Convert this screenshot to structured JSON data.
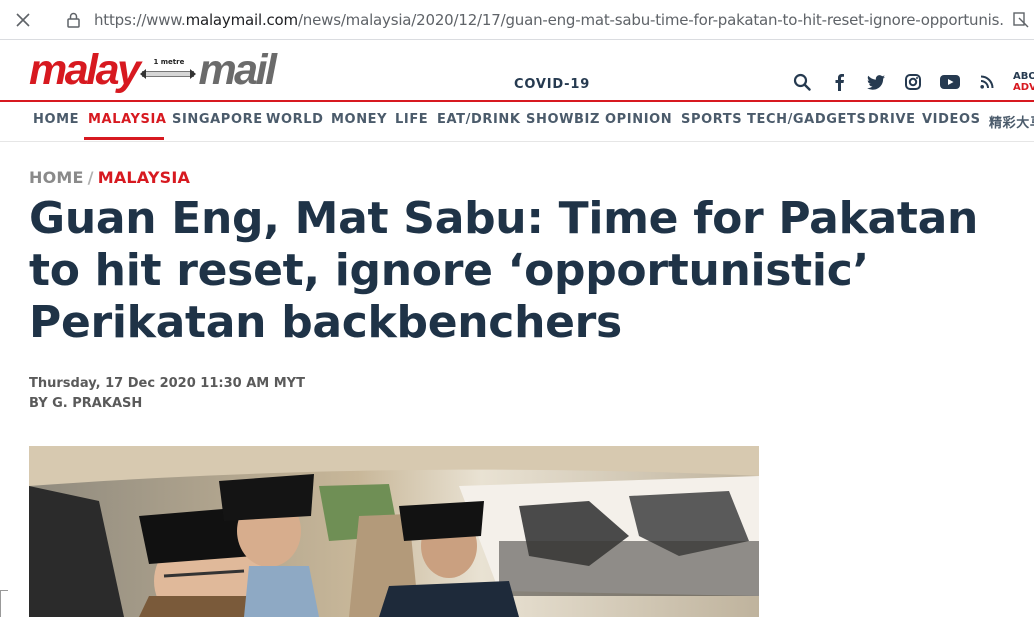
{
  "browser": {
    "url_prefix": "https://www.",
    "url_host": "malaymail.com",
    "url_path": "/news/malaysia/2020/12/17/guan-eng-mat-sabu-time-for-pakatan-to-hit-reset-ignore-opportunis..."
  },
  "header": {
    "logo_left": "malay",
    "logo_ruler": "1 metre",
    "logo_right": "mail",
    "covid_label": "COVID-19",
    "about_top": "ABO",
    "about_bottom": "ADV"
  },
  "nav": {
    "items": [
      {
        "label": "HOME"
      },
      {
        "label": "MALAYSIA"
      },
      {
        "label": "SINGAPORE"
      },
      {
        "label": "WORLD"
      },
      {
        "label": "MONEY"
      },
      {
        "label": "LIFE"
      },
      {
        "label": "EAT/DRINK"
      },
      {
        "label": "SHOWBIZ"
      },
      {
        "label": "OPINION"
      },
      {
        "label": "SPORTS"
      },
      {
        "label": "TECH/GADGETS"
      },
      {
        "label": "DRIVE"
      },
      {
        "label": "VIDEOS"
      },
      {
        "label": "精彩大马"
      }
    ],
    "active_index": 1
  },
  "article": {
    "crumb_home": "HOME",
    "crumb_sep": "/",
    "crumb_section": "MALAYSIA",
    "headline": "Guan Eng, Mat Sabu: Time for Pakatan to hit reset, ignore ‘opportunistic’ Perikatan backbenchers",
    "date": "Thursday, 17 Dec 2020 11:30 AM MYT",
    "byline": "BY G. PRAKASH"
  },
  "icons": [
    "close-icon",
    "lock-icon",
    "extension-icon",
    "search-icon",
    "facebook-icon",
    "twitter-icon",
    "instagram-icon",
    "youtube-icon",
    "rss-icon"
  ],
  "colors": {
    "brand_red": "#d71920",
    "navy": "#1f3347",
    "nav_text": "#4b5b6b"
  }
}
